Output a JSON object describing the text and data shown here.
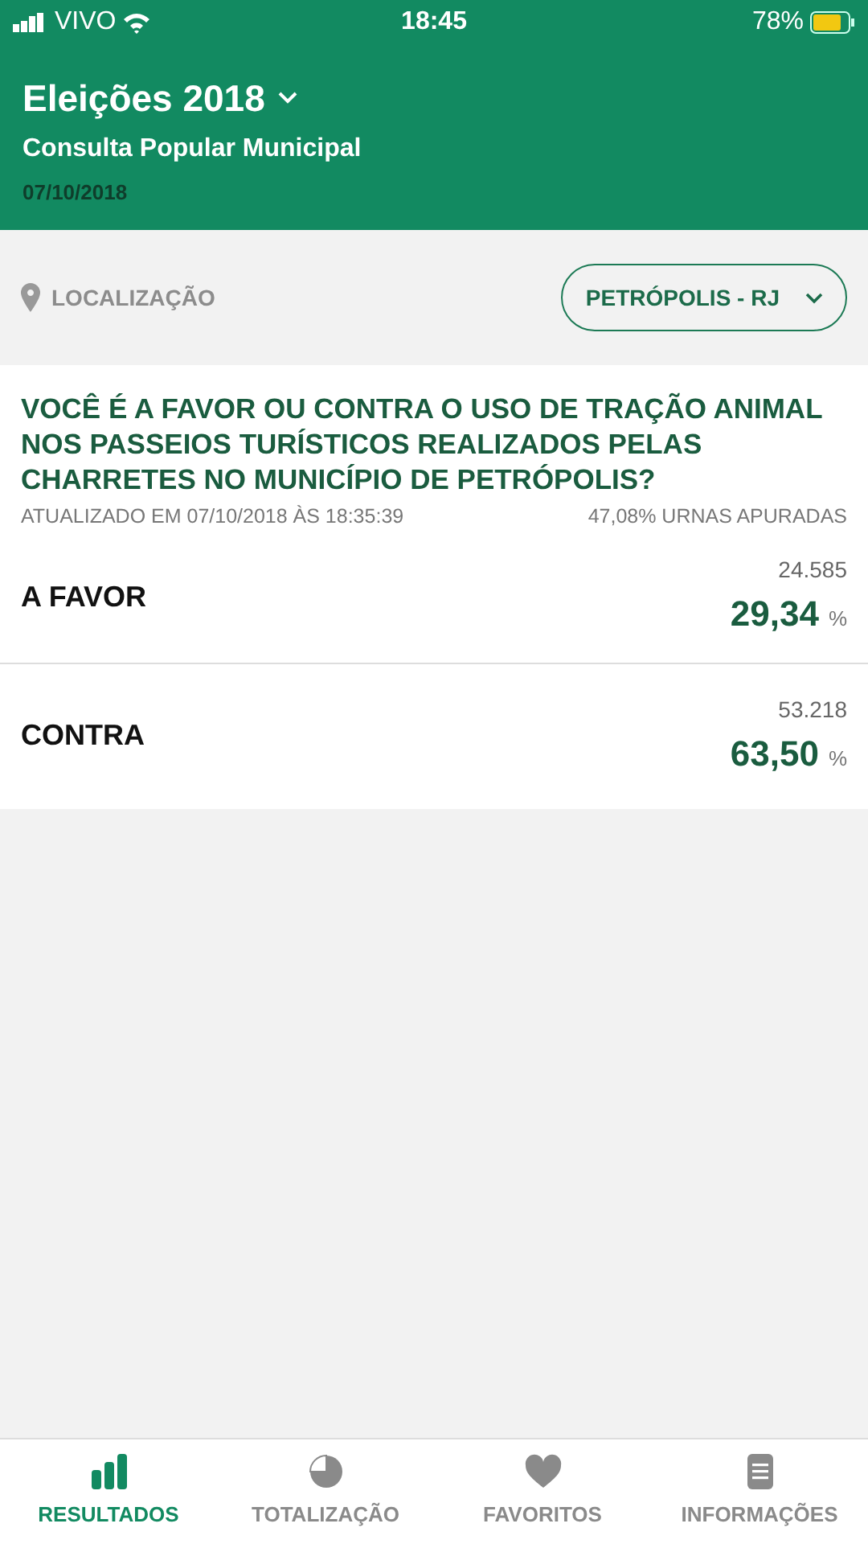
{
  "status_bar": {
    "carrier": "VIVO",
    "time": "18:45",
    "battery": "78%"
  },
  "header": {
    "title": "Eleições 2018",
    "subtitle": "Consulta Popular Municipal",
    "date": "07/10/2018"
  },
  "location": {
    "label": "LOCALIZAÇÃO",
    "selector": "PETRÓPOLIS - RJ"
  },
  "question": {
    "text": "VOCÊ É A FAVOR OU CONTRA O USO DE TRAÇÃO ANIMAL NOS PASSEIOS TURÍSTICOS REALIZADOS PELAS CHARRETES NO MUNICÍPIO DE PETRÓPOLIS?",
    "updated": "ATUALIZADO EM 07/10/2018 ÀS 18:35:39",
    "counted": "47,08% URNAS APURADAS"
  },
  "options": [
    {
      "label": "A FAVOR",
      "votes": "24.585",
      "percent": "29,34",
      "unit": "%"
    },
    {
      "label": "CONTRA",
      "votes": "53.218",
      "percent": "63,50",
      "unit": "%"
    }
  ],
  "tabs": [
    {
      "kind": "results",
      "label": "RESULTADOS",
      "selected": true
    },
    {
      "kind": "total",
      "label": "TOTALIZAÇÃO",
      "selected": false
    },
    {
      "kind": "favorites",
      "label": "FAVORITOS",
      "selected": false
    },
    {
      "kind": "info",
      "label": "INFORMAÇÕES",
      "selected": false
    }
  ]
}
